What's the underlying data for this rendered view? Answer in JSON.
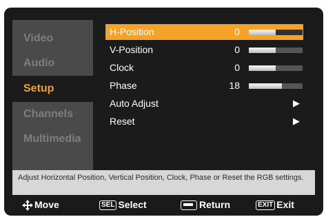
{
  "sidebar": {
    "items": [
      {
        "label": "Video"
      },
      {
        "label": "Audio"
      },
      {
        "label": "Setup"
      },
      {
        "label": "Channels"
      },
      {
        "label": "Multimedia"
      }
    ]
  },
  "menu": {
    "rows": [
      {
        "label": "H-Position",
        "value": "0",
        "level": 0.5
      },
      {
        "label": "V-Position",
        "value": "0",
        "level": 0.5
      },
      {
        "label": "Clock",
        "value": "0",
        "level": 0.5
      },
      {
        "label": "Phase",
        "value": "18",
        "level": 0.62
      },
      {
        "label": "Auto Adjust",
        "arrow": "▶"
      },
      {
        "label": "Reset",
        "arrow": "▶"
      }
    ]
  },
  "help_text": "Adjust Horizontal Position, Vertical Position, Clock, Phase or Reset the RGB settings.",
  "footer": {
    "move_label": "Move",
    "select_key": "SEL",
    "select_label": "Select",
    "return_label": "Return",
    "exit_key": "EXIT",
    "exit_label": "Exit"
  },
  "colors": {
    "accent": "#f4a328",
    "active_tab_text": "#f2a12e"
  }
}
